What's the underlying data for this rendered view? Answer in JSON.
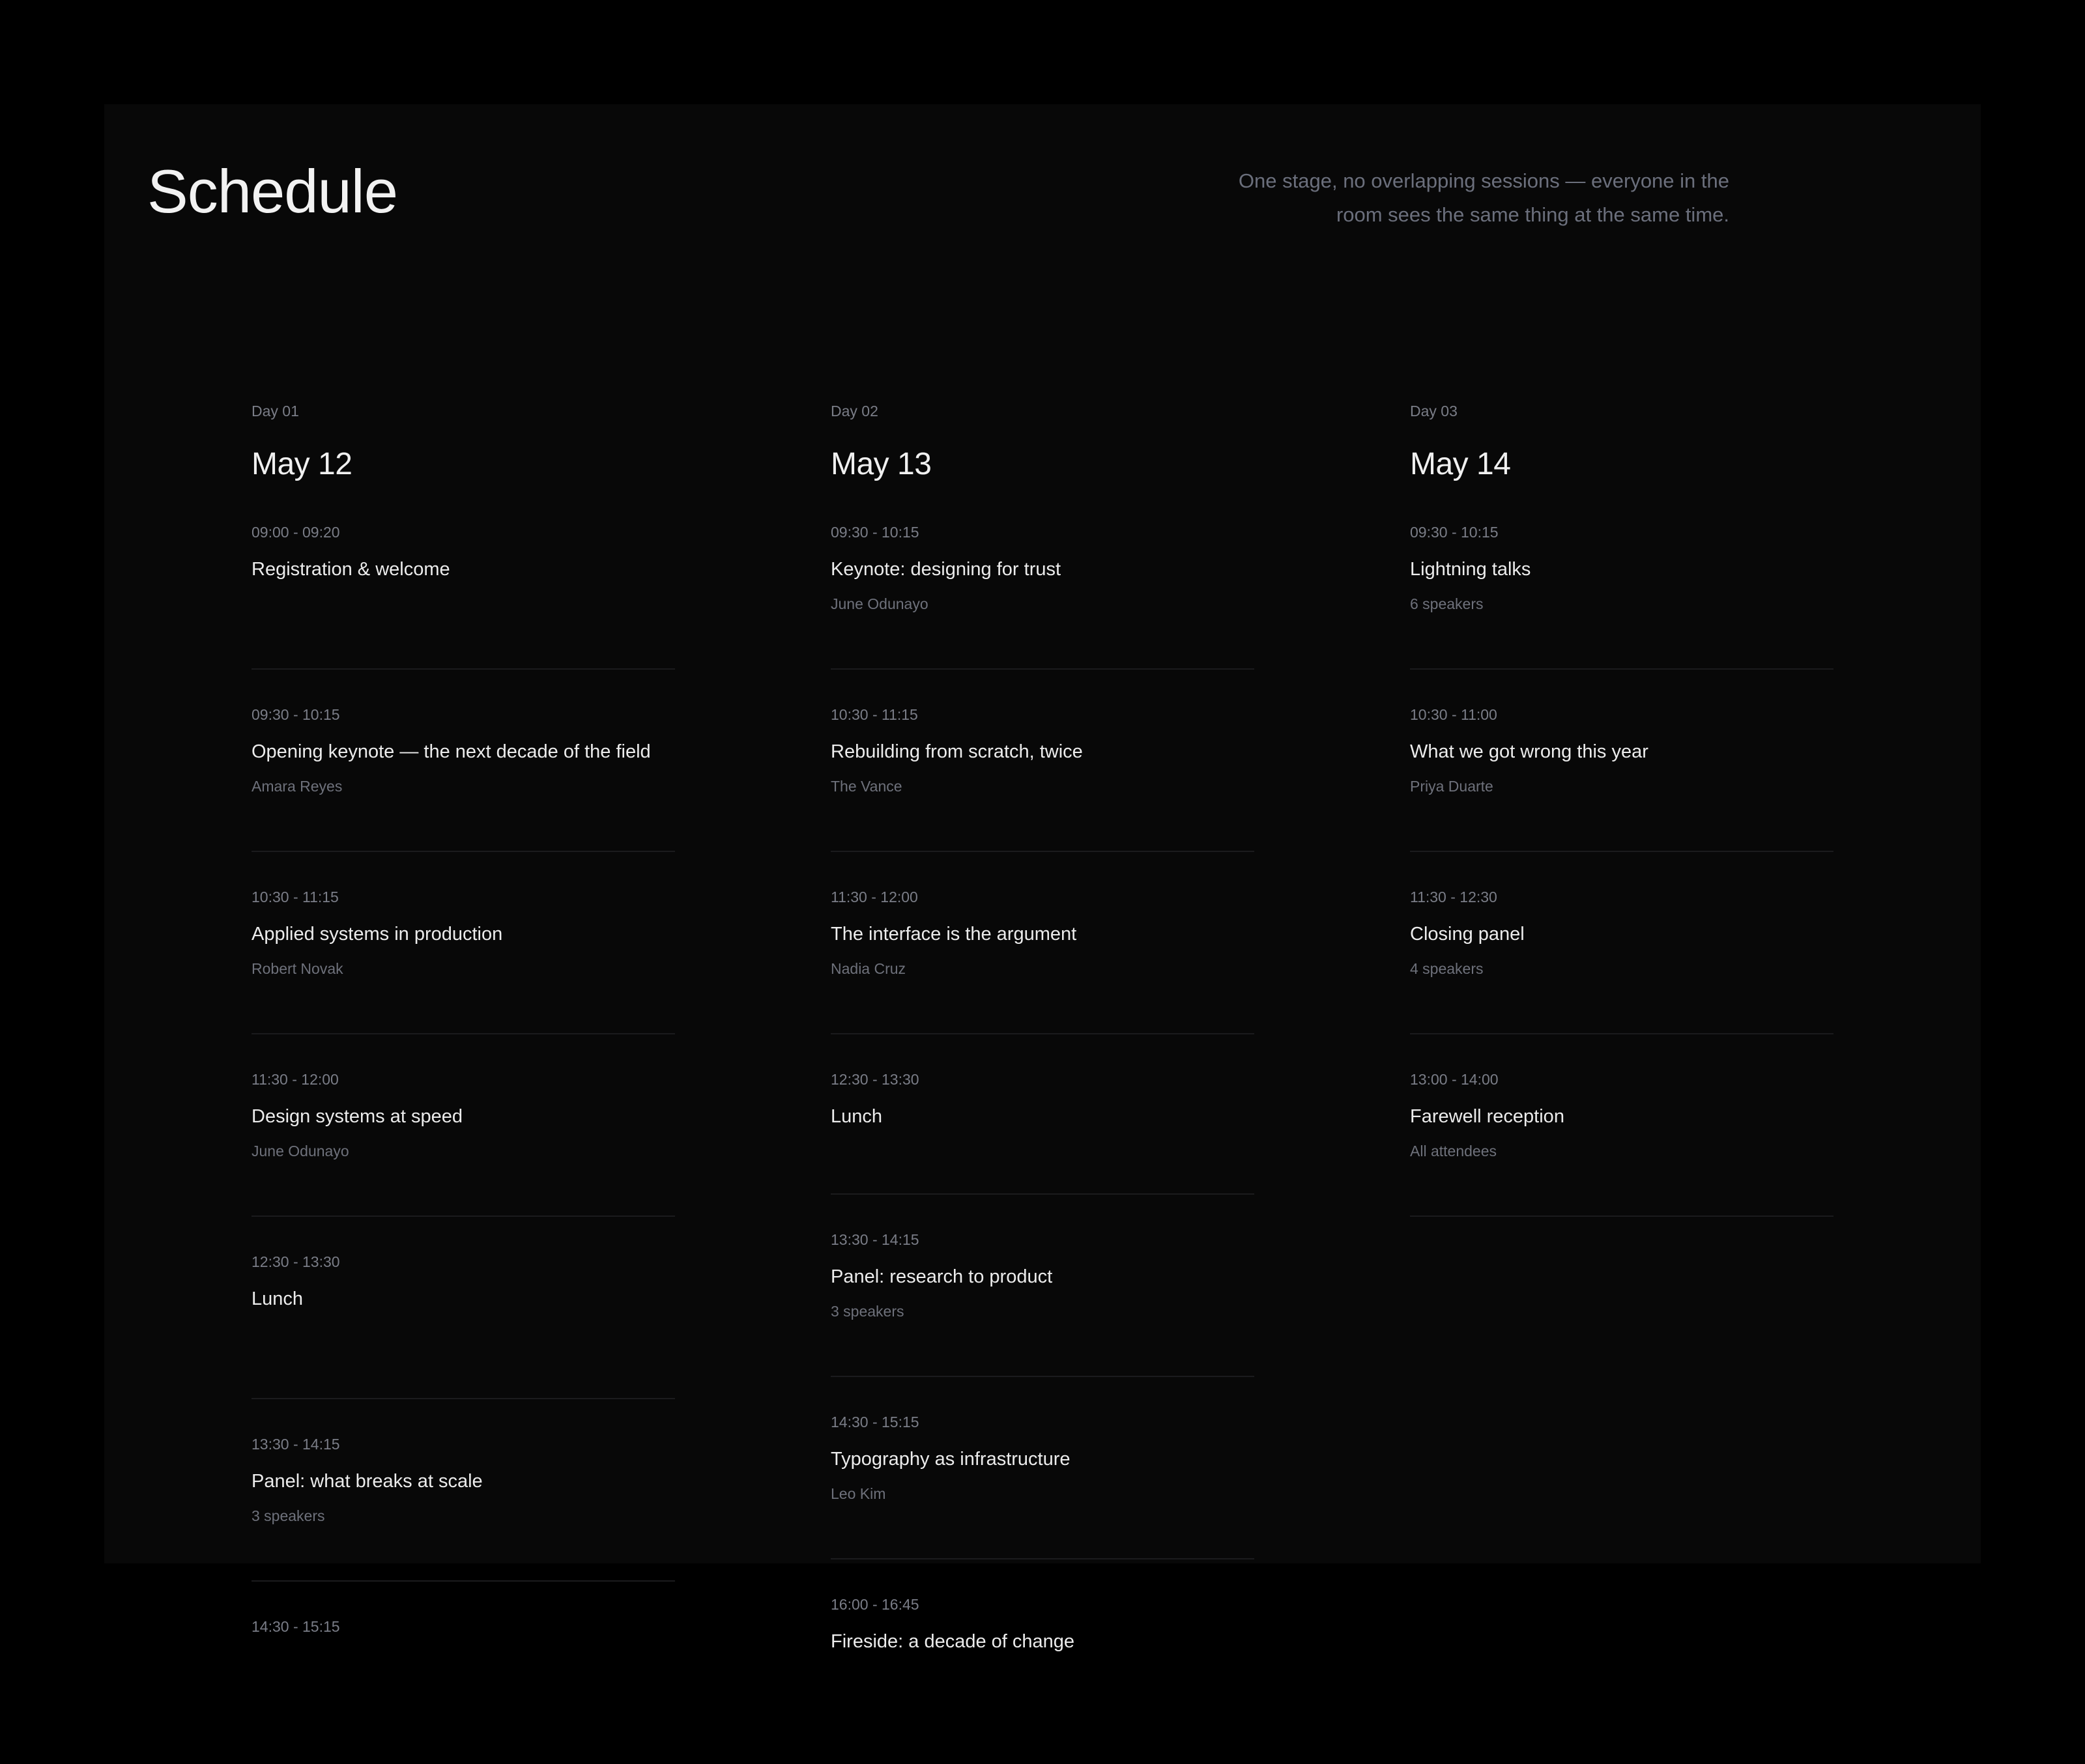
{
  "header": {
    "title": "Schedule",
    "tagline": "One stage, no overlapping sessions — everyone in the room sees the same thing at the same time."
  },
  "days": [
    {
      "label": "Day 01",
      "date": "May 12",
      "sessions": [
        {
          "time": "09:00 - 09:20",
          "title": "Registration & welcome",
          "speaker": ""
        },
        {
          "time": "09:30 - 10:15",
          "title": "Opening keynote — the next decade of the field",
          "speaker": "Amara Reyes"
        },
        {
          "time": "10:30 - 11:15",
          "title": "Applied systems in production",
          "speaker": "Robert Novak"
        },
        {
          "time": "11:30 - 12:00",
          "title": "Design systems at speed",
          "speaker": "June Odunayo"
        },
        {
          "time": "12:30 - 13:30",
          "title": "Lunch",
          "speaker": ""
        },
        {
          "time": "13:30 - 14:15",
          "title": "Panel: what breaks at scale",
          "speaker": "3 speakers"
        },
        {
          "time": "14:30 - 15:15",
          "title": "",
          "speaker": ""
        }
      ]
    },
    {
      "label": "Day 02",
      "date": "May 13",
      "sessions": [
        {
          "time": "09:30 - 10:15",
          "title": "Keynote: designing for trust",
          "speaker": "June Odunayo"
        },
        {
          "time": "10:30 - 11:15",
          "title": "Rebuilding from scratch, twice",
          "speaker": "The Vance"
        },
        {
          "time": "11:30 - 12:00",
          "title": "The interface is the argument",
          "speaker": "Nadia Cruz"
        },
        {
          "time": "12:30 - 13:30",
          "title": "Lunch",
          "speaker": ""
        },
        {
          "time": "13:30 - 14:15",
          "title": "Panel: research to product",
          "speaker": "3 speakers"
        },
        {
          "time": "14:30 - 15:15",
          "title": "Typography as infrastructure",
          "speaker": "Leo Kim"
        },
        {
          "time": "16:00 - 16:45",
          "title": "Fireside: a decade of change",
          "speaker": ""
        }
      ]
    },
    {
      "label": "Day 03",
      "date": "May 14",
      "sessions": [
        {
          "time": "09:30 - 10:15",
          "title": "Lightning talks",
          "speaker": "6 speakers"
        },
        {
          "time": "10:30 - 11:00",
          "title": "What we got wrong this year",
          "speaker": "Priya Duarte"
        },
        {
          "time": "11:30 - 12:30",
          "title": "Closing panel",
          "speaker": "4 speakers"
        },
        {
          "time": "13:00 - 14:00",
          "title": "Farewell reception",
          "speaker": "All attendees"
        }
      ]
    }
  ]
}
